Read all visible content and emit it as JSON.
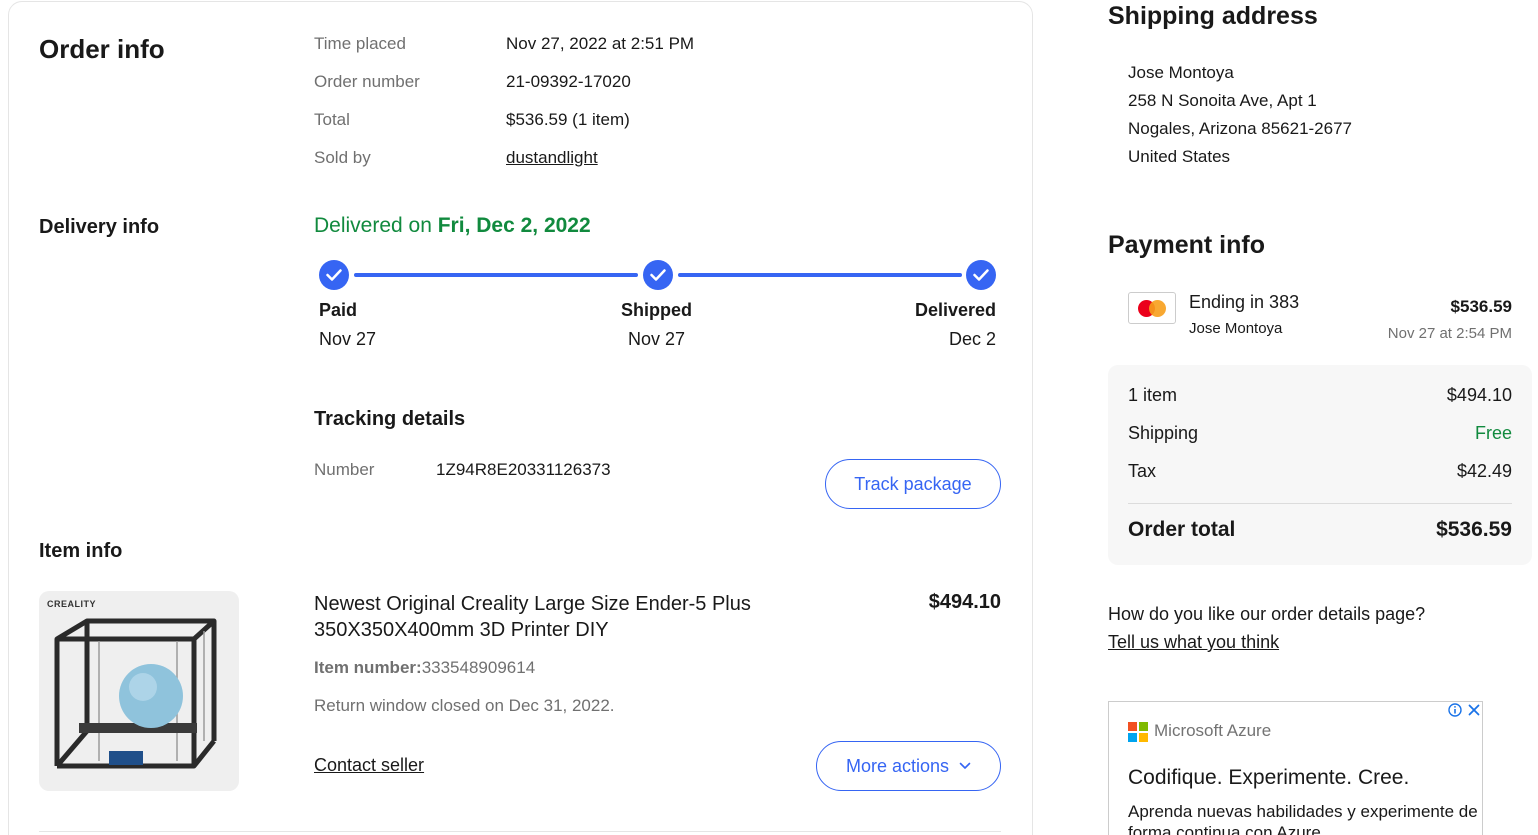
{
  "order_info": {
    "title": "Order info",
    "rows": [
      {
        "label": "Time placed",
        "value": "Nov 27, 2022 at 2:51 PM"
      },
      {
        "label": "Order number",
        "value": "21-09392-17020"
      },
      {
        "label": "Total",
        "value": "$536.59 (1 item)"
      },
      {
        "label": "Sold by",
        "value": "dustandlight"
      }
    ]
  },
  "delivery_info": {
    "title": "Delivery info",
    "status_prefix": "Delivered on ",
    "status_date": "Fri, Dec 2, 2022",
    "steps": [
      {
        "label": "Paid",
        "date": "Nov 27"
      },
      {
        "label": "Shipped",
        "date": "Nov 27"
      },
      {
        "label": "Delivered",
        "date": "Dec 2"
      }
    ],
    "progress_fraction": 1.0,
    "tracking_title": "Tracking details",
    "tracking_label": "Number",
    "tracking_number": "1Z94R8E20331126373",
    "track_button": "Track package"
  },
  "item_info": {
    "title": "Item info",
    "image_brand": "CREALITY",
    "item_title": "Newest Original Creality Large Size Ender-5 Plus 350X350X400mm 3D Printer DIY",
    "price": "$494.10",
    "item_number_label": "Item number:",
    "item_number": "333548909614",
    "return_window": "Return window closed on Dec 31, 2022.",
    "contact_seller": "Contact seller",
    "more_actions": "More actions"
  },
  "shipping_address": {
    "title": "Shipping address",
    "lines": [
      "Jose Montoya",
      "258 N Sonoita Ave, Apt 1",
      "Nogales, Arizona 85621-2677",
      "United States"
    ]
  },
  "payment_info": {
    "title": "Payment info",
    "card_ending": "Ending in 383",
    "card_holder": "Jose Montoya",
    "amount": "$536.59",
    "time": "Nov 27 at 2:54 PM",
    "summary": [
      {
        "label": "1 item",
        "value": "$494.10"
      },
      {
        "label": "Shipping",
        "value": "Free"
      },
      {
        "label": "Tax",
        "value": "$42.49"
      }
    ],
    "total_label": "Order total",
    "total_value": "$536.59"
  },
  "feedback": {
    "question": "How do you like our order details page?",
    "link": "Tell us what you think"
  },
  "ad": {
    "brand": "Microsoft Azure",
    "headline": "Codifique. Experimente. Cree.",
    "body": "Aprenda nuevas habilidades y experimente de forma continua con Azure"
  },
  "colors": {
    "accent": "#3665f3",
    "success": "#118a3e",
    "muted": "#707070"
  }
}
